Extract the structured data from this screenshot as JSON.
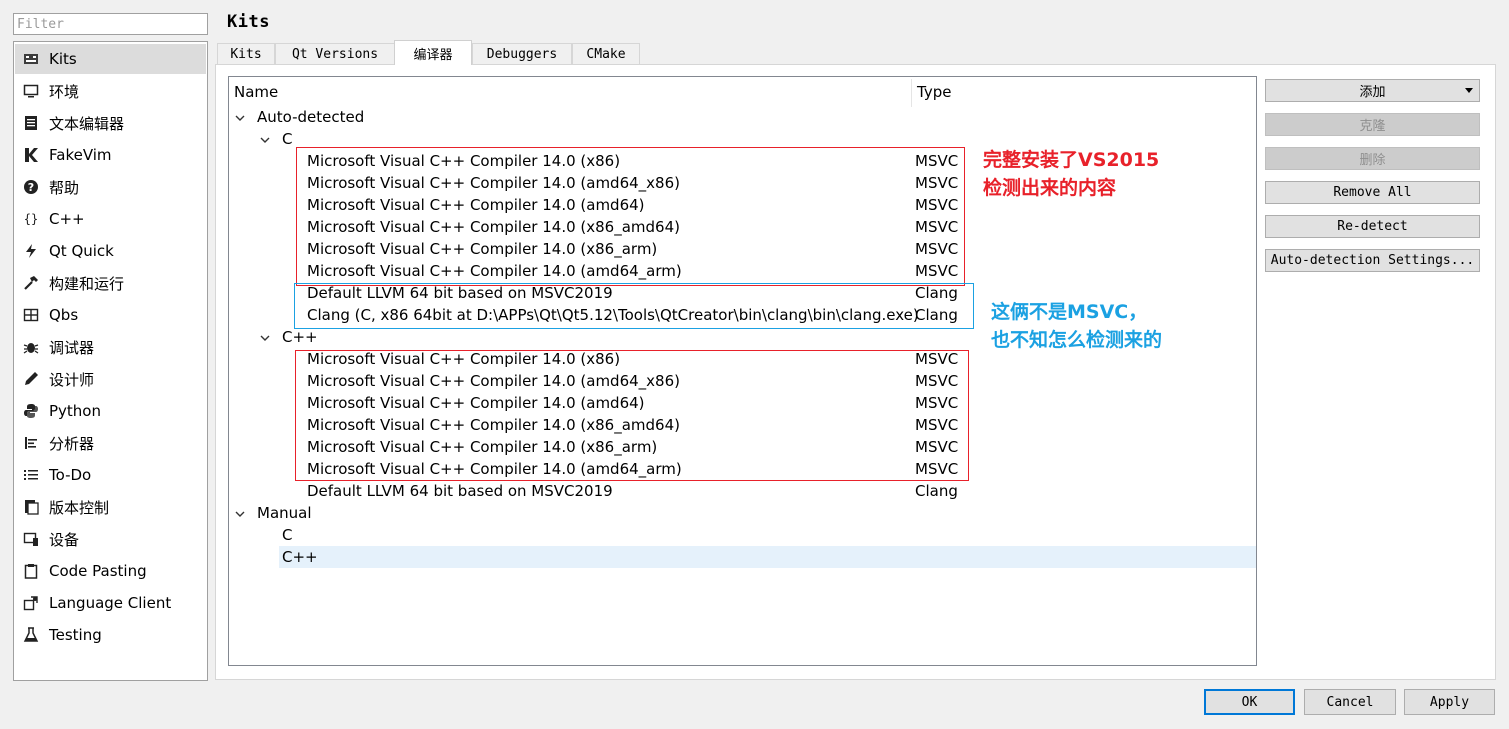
{
  "colors": {
    "annotation_red": "#e8212a",
    "annotation_blue": "#1ba1e2",
    "selection": "#e5f1fb",
    "default_button_border": "#0078d7"
  },
  "filter": {
    "placeholder": "Filter",
    "value": ""
  },
  "sidebar": {
    "items": [
      {
        "label": "Kits",
        "icon": "kits-icon"
      },
      {
        "label": "环境",
        "icon": "monitor-icon"
      },
      {
        "label": "文本编辑器",
        "icon": "text-editor-icon"
      },
      {
        "label": "FakeVim",
        "icon": "fakevim-icon"
      },
      {
        "label": "帮助",
        "icon": "help-icon"
      },
      {
        "label": "C++",
        "icon": "braces-icon"
      },
      {
        "label": "Qt Quick",
        "icon": "qt-quick-icon"
      },
      {
        "label": "构建和运行",
        "icon": "hammer-icon"
      },
      {
        "label": "Qbs",
        "icon": "qbs-icon"
      },
      {
        "label": "调试器",
        "icon": "bug-icon"
      },
      {
        "label": "设计师",
        "icon": "pen-icon"
      },
      {
        "label": "Python",
        "icon": "python-icon"
      },
      {
        "label": "分析器",
        "icon": "analyzer-icon"
      },
      {
        "label": "To-Do",
        "icon": "todo-icon"
      },
      {
        "label": "版本控制",
        "icon": "version-control-icon"
      },
      {
        "label": "设备",
        "icon": "device-icon"
      },
      {
        "label": "Code Pasting",
        "icon": "paste-icon"
      },
      {
        "label": "Language Client",
        "icon": "language-client-icon"
      },
      {
        "label": "Testing",
        "icon": "flask-icon"
      }
    ]
  },
  "header": {
    "title": "Kits"
  },
  "tabs": [
    {
      "label": "Kits"
    },
    {
      "label": "Qt Versions"
    },
    {
      "label": "编译器"
    },
    {
      "label": "Debuggers"
    },
    {
      "label": "CMake"
    }
  ],
  "tree": {
    "headers": {
      "name": "Name",
      "type": "Type"
    },
    "auto_detected": "Auto-detected",
    "c_group": "C",
    "c_items": [
      {
        "name": "Microsoft Visual C++ Compiler 14.0 (x86)",
        "type": "MSVC"
      },
      {
        "name": "Microsoft Visual C++ Compiler 14.0 (amd64_x86)",
        "type": "MSVC"
      },
      {
        "name": "Microsoft Visual C++ Compiler 14.0 (amd64)",
        "type": "MSVC"
      },
      {
        "name": "Microsoft Visual C++ Compiler 14.0 (x86_amd64)",
        "type": "MSVC"
      },
      {
        "name": "Microsoft Visual C++ Compiler 14.0 (x86_arm)",
        "type": "MSVC"
      },
      {
        "name": "Microsoft Visual C++ Compiler 14.0 (amd64_arm)",
        "type": "MSVC"
      },
      {
        "name": "Default LLVM 64 bit based on MSVC2019",
        "type": "Clang"
      },
      {
        "name": "Clang (C, x86 64bit at D:\\APPs\\Qt\\Qt5.12\\Tools\\QtCreator\\bin\\clang\\bin\\clang.exe)",
        "type": "Clang"
      }
    ],
    "cpp_group": "C++",
    "cpp_items": [
      {
        "name": "Microsoft Visual C++ Compiler 14.0 (x86)",
        "type": "MSVC"
      },
      {
        "name": "Microsoft Visual C++ Compiler 14.0 (amd64_x86)",
        "type": "MSVC"
      },
      {
        "name": "Microsoft Visual C++ Compiler 14.0 (amd64)",
        "type": "MSVC"
      },
      {
        "name": "Microsoft Visual C++ Compiler 14.0 (x86_amd64)",
        "type": "MSVC"
      },
      {
        "name": "Microsoft Visual C++ Compiler 14.0 (x86_arm)",
        "type": "MSVC"
      },
      {
        "name": "Microsoft Visual C++ Compiler 14.0 (amd64_arm)",
        "type": "MSVC"
      },
      {
        "name": "Default LLVM 64 bit based on MSVC2019",
        "type": "Clang"
      }
    ],
    "manual": "Manual",
    "manual_c": "C",
    "manual_cpp": "C++"
  },
  "buttons": {
    "add": "添加",
    "clone": "克隆",
    "delete": "删除",
    "remove_all": "Remove All",
    "redetect": "Re-detect",
    "auto_detection_settings": "Auto-detection Settings..."
  },
  "dialog": {
    "ok": "OK",
    "cancel": "Cancel",
    "apply": "Apply"
  },
  "annotations": {
    "red_line1": "完整安装了VS2015",
    "red_line2": "检测出来的内容",
    "blue_line1": "这俩不是MSVC，",
    "blue_line2": "也不知怎么检测来的"
  }
}
